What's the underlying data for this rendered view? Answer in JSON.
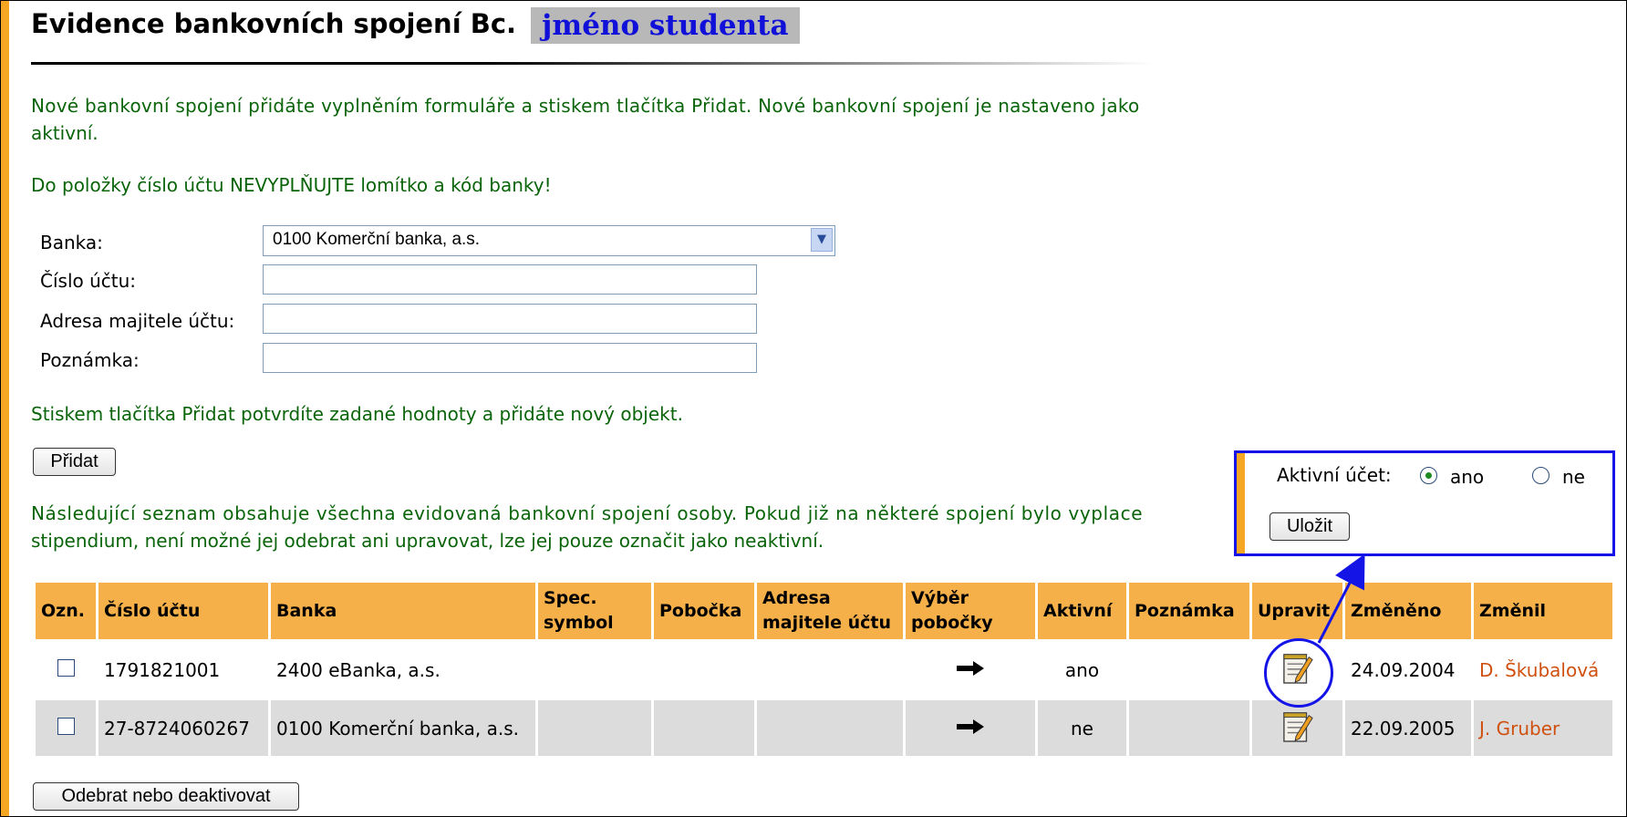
{
  "header": {
    "title": "Evidence bankovních spojení Bc.",
    "student_name": "jméno studenta"
  },
  "intro": {
    "line1": "Nové bankovní spojení přidáte vyplněním formuláře a stiskem tlačítka Přidat. Nové bankovní spojení je nastaveno jako",
    "line2": "aktivní.",
    "warning": "Do položky číslo účtu NEVYPLŇUJTE lomítko a kód banky!"
  },
  "form": {
    "bank_label": "Banka:",
    "bank_value": "0100 Komerční banka, a.s.",
    "account_label": "Číslo účtu:",
    "owner_label": "Adresa majitele účtu:",
    "note_label": "Poznámka:",
    "account_value": "",
    "owner_value": "",
    "note_value": "",
    "submit_hint": "Stiskem tlačítka Přidat potvrdíte zadané hodnoty a přidáte nový objekt.",
    "add_button": "Přidat"
  },
  "list_info": {
    "line1": "Následující seznam obsahuje všechna evidovaná bankovní spojení osoby. Pokud již na některé spojení bylo vyplace",
    "line2": "stipendium, není možné jej odebrat ani upravovat, lze jej pouze označit jako neaktivní."
  },
  "table": {
    "headers": [
      "Ozn.",
      "Číslo účtu",
      "Banka",
      "Spec. symbol",
      "Pobočka",
      "Adresa majitele účtu",
      "Výběr pobočky",
      "Aktivní",
      "Poznámka",
      "Upravit",
      "Změněno",
      "Změnil"
    ],
    "rows": [
      {
        "account": "1791821001",
        "bank": "2400 eBanka, a.s.",
        "spec": "",
        "branch": "",
        "owner": "",
        "active": "ano",
        "note": "",
        "changed": "24.09.2004",
        "changed_by": "D. Škubalová"
      },
      {
        "account": "27-8724060267",
        "bank": "0100 Komerční banka, a.s.",
        "spec": "",
        "branch": "",
        "owner": "",
        "active": "ne",
        "note": "",
        "changed": "22.09.2005",
        "changed_by": "J. Gruber"
      }
    ]
  },
  "remove_button": "Odebrat nebo deaktivovat",
  "popup": {
    "label": "Aktivní účet:",
    "option_yes": "ano",
    "option_no": "ne",
    "selected": "ano",
    "save_button": "Uložit"
  },
  "colors": {
    "accent": "#f5a623",
    "header_bg": "#f5b04a",
    "info_text": "#0a640a",
    "annotation": "#1414e6",
    "link": "#d05010"
  },
  "icons": [
    "arrow-right-icon",
    "edit-notepad-icon",
    "select-chevron-icon"
  ]
}
